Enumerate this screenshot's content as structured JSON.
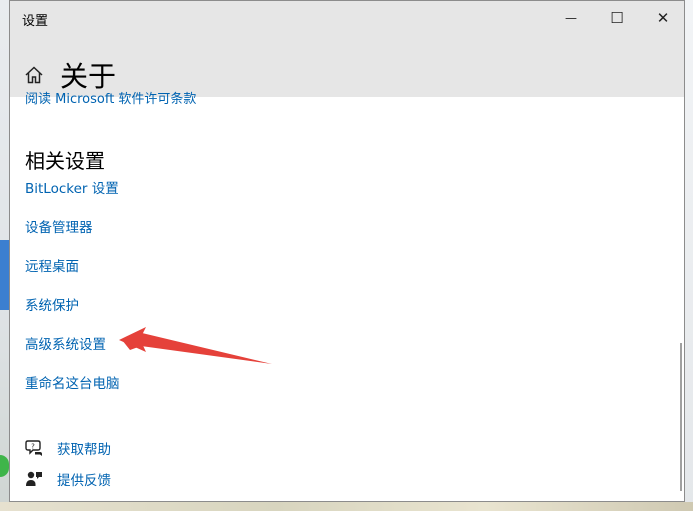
{
  "window": {
    "title": "设置",
    "minimize_glyph": "—",
    "maximize_glyph": "☐",
    "close_glyph": "✕"
  },
  "header": {
    "icon": "home-icon",
    "title": "关于"
  },
  "content": {
    "clipped_link": "阅读 Microsoft 软件许可条款",
    "section_title": "相关设置",
    "links": [
      "BitLocker 设置",
      "设备管理器",
      "远程桌面",
      "系统保护",
      "高级系统设置",
      "重命名这台电脑"
    ],
    "help": [
      {
        "icon": "help-chat-icon",
        "label": "获取帮助"
      },
      {
        "icon": "feedback-icon",
        "label": "提供反馈"
      }
    ]
  },
  "colors": {
    "link": "#0063b1",
    "arrow": "#e5413a",
    "header_bg": "#e6e6e6"
  }
}
